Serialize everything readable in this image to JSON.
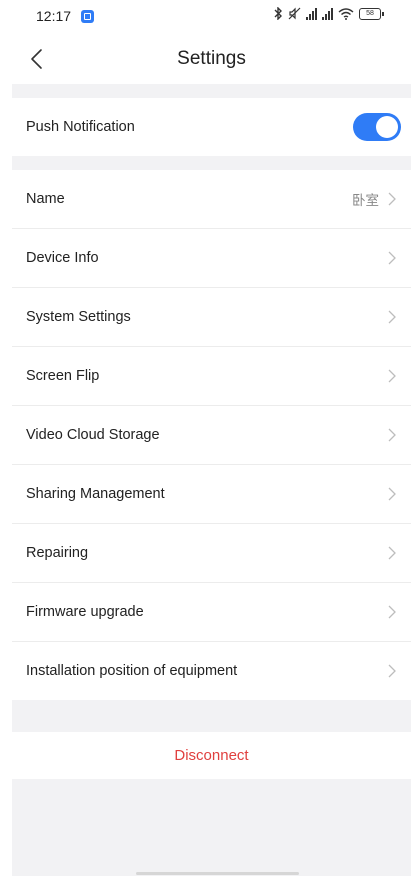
{
  "status_bar": {
    "time": "12:17",
    "battery": "58"
  },
  "header": {
    "title": "Settings"
  },
  "push_notification": {
    "label": "Push Notification",
    "enabled": true
  },
  "settings": {
    "items": [
      {
        "label": "Name",
        "value": "卧室"
      },
      {
        "label": "Device Info"
      },
      {
        "label": "System Settings"
      },
      {
        "label": "Screen Flip"
      },
      {
        "label": "Video Cloud Storage"
      },
      {
        "label": "Sharing Management"
      },
      {
        "label": "Repairing"
      },
      {
        "label": "Firmware upgrade"
      },
      {
        "label": "Installation position of equipment"
      }
    ]
  },
  "actions": {
    "disconnect_label": "Disconnect"
  },
  "colors": {
    "accent": "#2f7cf6",
    "danger": "#e0403f",
    "background": "#f2f2f4"
  }
}
